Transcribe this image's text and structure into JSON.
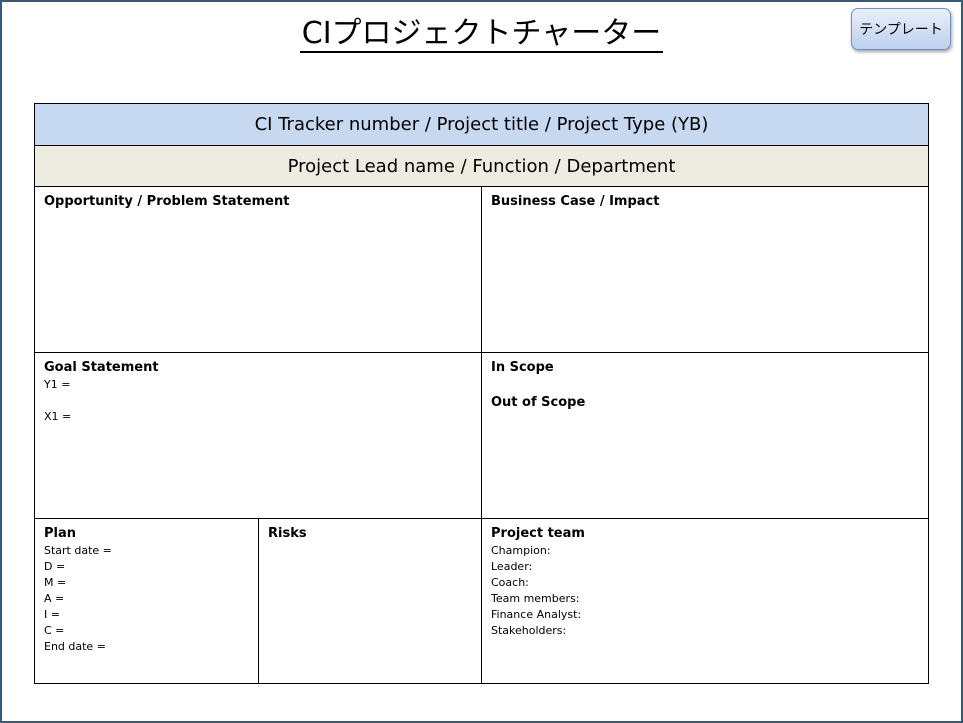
{
  "title": "CIプロジェクトチャーター",
  "template_button": "テンプレート",
  "bands": {
    "tracker": "CI Tracker number / Project title / Project Type (YB)",
    "lead": "Project Lead name / Function / Department"
  },
  "sections": {
    "opportunity": "Opportunity / Problem Statement",
    "business_case": "Business Case / Impact",
    "goal": {
      "heading": "Goal Statement",
      "y1": "Y1 =",
      "x1": "X1 ="
    },
    "scope": {
      "in_scope": "In Scope",
      "out_of_scope": "Out of Scope"
    },
    "plan": {
      "heading": "Plan",
      "lines": [
        "Start date =",
        "D =",
        "M =",
        "A =",
        "I =",
        "C =",
        "End date ="
      ]
    },
    "risks": "Risks",
    "team": {
      "heading": "Project team",
      "lines": [
        "Champion:",
        "Leader:",
        "Coach:",
        "Team members:",
        "Finance Analyst:",
        "Stakeholders:"
      ]
    }
  }
}
